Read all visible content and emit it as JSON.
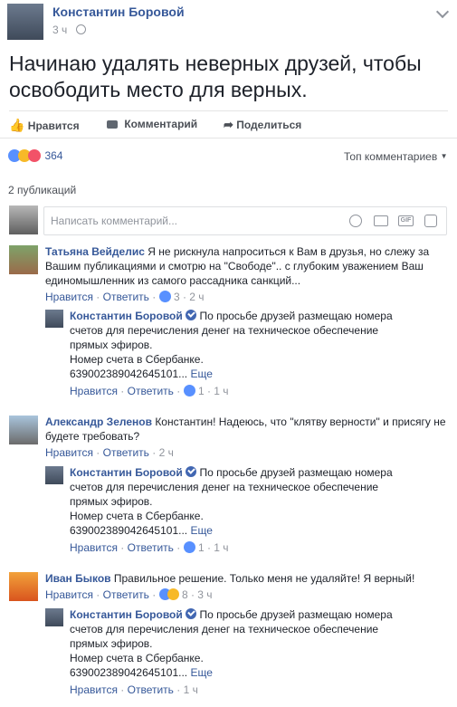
{
  "post": {
    "author": "Константин Боровой",
    "time": "3 ч",
    "text": "Начинаю удалять неверных друзей, чтобы освободить место для верных."
  },
  "actions": {
    "like": "Нравится",
    "comment": "Комментарий",
    "share": "Поделиться"
  },
  "reactions": {
    "count": "364",
    "sort": "Топ комментариев"
  },
  "publications": "2 публикаций",
  "composer": {
    "placeholder": "Написать комментарий..."
  },
  "labels": {
    "like": "Нравится",
    "reply": "Ответить",
    "more": "Еще"
  },
  "comments": [
    {
      "author": "Татьяна Вейделис",
      "text": "Я не рискнула напроситься к Вам в друзья, но слежу за Вашим публикациями и смотрю на \"Свободе\".. с глубоким уважением Ваш единомышленник из самого рассадника санкций...",
      "likes": "3",
      "time": "2 ч",
      "reply": {
        "author": "Константин Боровой",
        "text": "По просьбе друзей размещаю номера счетов для перечисления денег на техническое обеспечение прямых эфиров.",
        "line2": "Номер счета в Сбербанке.",
        "line3": "639002389042645101...",
        "likes": "1",
        "time": "1 ч"
      }
    },
    {
      "author": "Александр Зеленов",
      "text": "Константин! Надеюсь, что \"клятву верности\" и присягу не будете требовать?",
      "time": "2 ч",
      "reply": {
        "author": "Константин Боровой",
        "text": "По просьбе друзей размещаю номера счетов для перечисления денег на техническое обеспечение прямых эфиров.",
        "line2": "Номер счета в Сбербанке.",
        "line3": "639002389042645101...",
        "likes": "1",
        "time": "1 ч"
      }
    },
    {
      "author": "Иван Быков",
      "text": "Правильное решение. Только меня не удаляйте! Я верный!",
      "likes": "8",
      "time": "3 ч",
      "reply": {
        "author": "Константин Боровой",
        "text": "По просьбе друзей размещаю номера счетов для перечисления денег на техническое обеспечение прямых эфиров.",
        "line2": "Номер счета в Сбербанке.",
        "line3": "639002389042645101...",
        "time": "1 ч"
      }
    }
  ]
}
